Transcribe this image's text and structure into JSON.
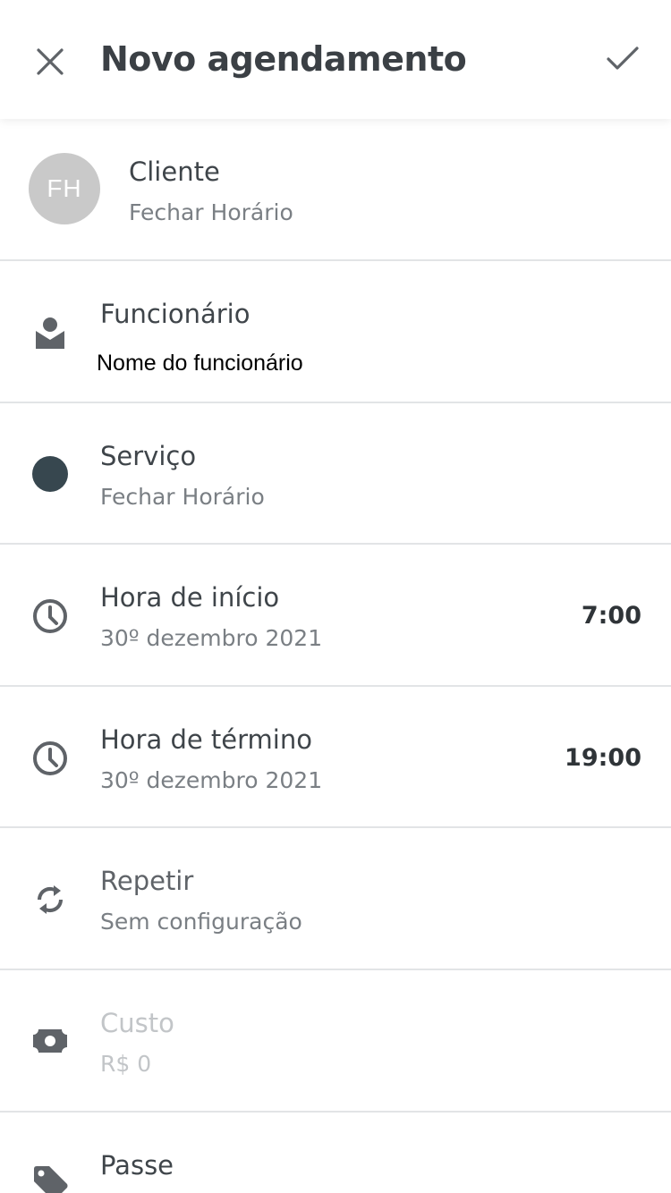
{
  "header": {
    "title": "Novo agendamento",
    "close_icon": "close-icon",
    "confirm_icon": "check-icon"
  },
  "client": {
    "label": "Cliente",
    "value": "Fechar Horário",
    "avatar_initials": "FH",
    "avatar_color": "#c9c9c9"
  },
  "employee": {
    "label": "Funcionário",
    "value": "Nome do funcionário",
    "icon": "person-icon"
  },
  "service": {
    "label": "Serviço",
    "value": "Fechar Horário",
    "color": "#37474f"
  },
  "start": {
    "label": "Hora de início",
    "date": "30º dezembro 2021",
    "time": "7:00",
    "icon": "clock-icon"
  },
  "end": {
    "label": "Hora de término",
    "date": "30º dezembro 2021",
    "time": "19:00",
    "icon": "clock-icon"
  },
  "repeat": {
    "label": "Repetir",
    "value": "Sem configuração",
    "icon": "repeat-icon"
  },
  "cost": {
    "label": "Custo",
    "value": "R$ 0",
    "icon": "money-icon"
  },
  "pass": {
    "label": "Passe",
    "icon": "tag-icon"
  }
}
